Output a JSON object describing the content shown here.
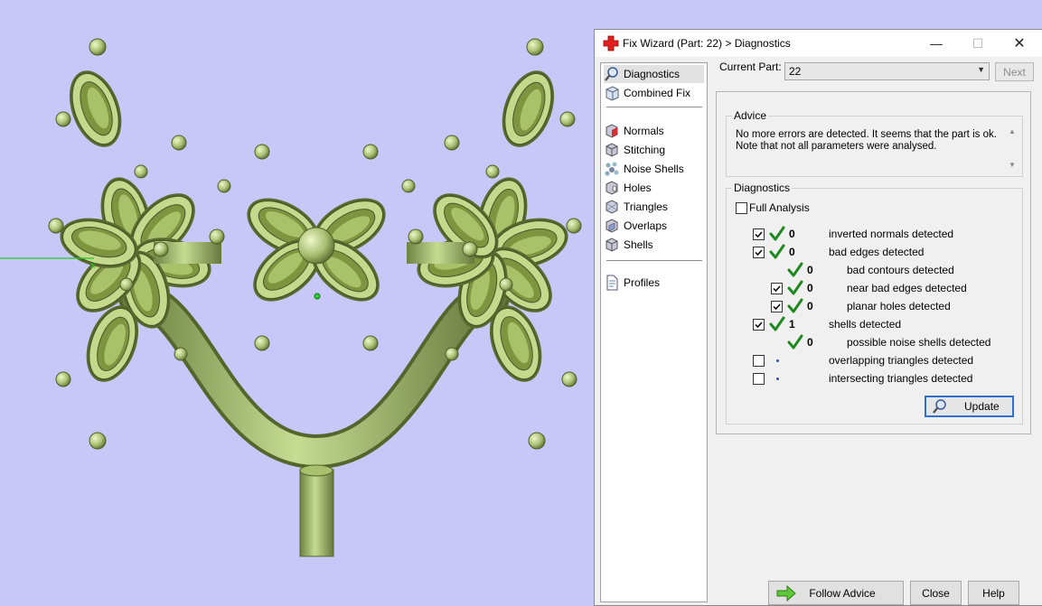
{
  "window": {
    "title": "Fix Wizard (Part: 22) > Diagnostics",
    "icon": "red-cross-icon",
    "minimize_glyph": "—",
    "maximize_glyph": "☐",
    "close_glyph": "✕"
  },
  "sidebar": {
    "items": [
      {
        "label": "Diagnostics",
        "icon": "magnifier-icon"
      },
      {
        "label": "Combined Fix",
        "icon": "combined-fix-icon"
      },
      {
        "label": "Normals",
        "icon": "normals-cube-icon"
      },
      {
        "label": "Stitching",
        "icon": "stitching-cube-icon"
      },
      {
        "label": "Noise Shells",
        "icon": "noise-shells-icon"
      },
      {
        "label": "Holes",
        "icon": "holes-cube-icon"
      },
      {
        "label": "Triangles",
        "icon": "triangles-cube-icon"
      },
      {
        "label": "Overlaps",
        "icon": "overlaps-cube-icon"
      },
      {
        "label": "Shells",
        "icon": "shells-cube-icon"
      },
      {
        "label": "Profiles",
        "icon": "profile-document-icon"
      }
    ]
  },
  "header": {
    "current_part_label": "Current Part:",
    "current_part_value": "22",
    "next_label": "Next"
  },
  "advice": {
    "group_label": "Advice",
    "line1": "No more errors are detected. It seems that the part is ok.",
    "line2": "Note that not all parameters were analysed."
  },
  "diagnostics": {
    "group_label": "Diagnostics",
    "full_analysis_label": "Full Analysis",
    "rows": [
      {
        "checked": true,
        "status": "ok",
        "count": "0",
        "label": "inverted normals detected"
      },
      {
        "checked": true,
        "status": "ok",
        "count": "0",
        "label": "bad edges detected"
      },
      {
        "checkbox": false,
        "status": "ok",
        "count": "0",
        "label": "bad contours detected"
      },
      {
        "checked": true,
        "status": "ok",
        "count": "0",
        "label": "near bad edges detected"
      },
      {
        "checked": true,
        "status": "ok",
        "count": "0",
        "label": "planar holes detected"
      },
      {
        "checked": true,
        "status": "ok",
        "count": "1",
        "label": "shells detected"
      },
      {
        "checkbox": false,
        "status": "ok",
        "count": "0",
        "label": "possible noise shells detected"
      },
      {
        "checked": false,
        "status": "not-run",
        "count": "",
        "label": "overlapping triangles detected"
      },
      {
        "checked": false,
        "status": "not-run",
        "count": "",
        "label": "intersecting triangles detected"
      }
    ],
    "update_label": "Update"
  },
  "footer": {
    "follow_advice_label": "Follow Advice",
    "close_label": "Close",
    "help_label": "Help"
  },
  "colors": {
    "viewport_background": "#c8c8f8",
    "model_green": "#b8d080",
    "ok_check_green": "#1e8a1e",
    "axis_line": "#22cc22"
  }
}
